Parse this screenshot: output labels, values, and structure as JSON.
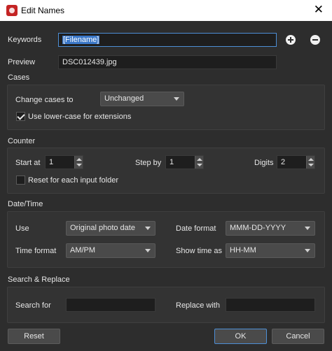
{
  "window": {
    "title": "Edit Names",
    "close_glyph": "✕"
  },
  "keywords": {
    "label": "Keywords",
    "value": "[Filename]"
  },
  "preview": {
    "label": "Preview",
    "value": "DSC012439.jpg"
  },
  "cases": {
    "section_label": "Cases",
    "change_label": "Change cases to",
    "change_value": "Unchanged",
    "lowercase_ext_label": "Use lower-case for extensions",
    "lowercase_ext_checked": true
  },
  "counter": {
    "section_label": "Counter",
    "start_label": "Start at",
    "start_value": "1",
    "step_label": "Step by",
    "step_value": "1",
    "digits_label": "Digits",
    "digits_value": "2",
    "reset_label": "Reset for each input folder",
    "reset_checked": false
  },
  "datetime": {
    "section_label": "Date/Time",
    "use_label": "Use",
    "use_value": "Original photo date",
    "date_format_label": "Date format",
    "date_format_value": "MMM-DD-YYYY",
    "time_format_label": "Time format",
    "time_format_value": "AM/PM",
    "show_time_label": "Show time as",
    "show_time_value": "HH-MM"
  },
  "search_replace": {
    "section_label": "Search & Replace",
    "search_label": "Search for",
    "search_value": "",
    "replace_label": "Replace with",
    "replace_value": ""
  },
  "buttons": {
    "reset": "Reset",
    "ok": "OK",
    "cancel": "Cancel"
  },
  "icons": {
    "add": "plus-circle-icon",
    "remove": "minus-circle-icon",
    "app": "app-icon"
  },
  "colors": {
    "background": "#2d2d2d",
    "focus_accent": "#4d8fd6",
    "selection": "#3b78c9"
  }
}
